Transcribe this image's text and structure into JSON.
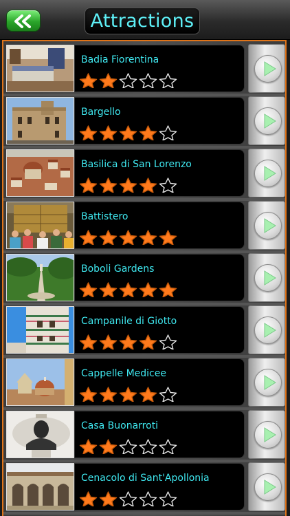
{
  "header": {
    "title": "Attractions",
    "back_icon": "double-chevron-left-icon",
    "colors": {
      "title": "#5ef0f7",
      "back_button": "#2aa52a",
      "frame": "#e07419",
      "star_on": "#ff7a1c"
    }
  },
  "attractions": [
    {
      "name": "Badia Fiorentina",
      "rating": 2,
      "thumb_icon": "interior-room-photo"
    },
    {
      "name": "Bargello",
      "rating": 4,
      "thumb_icon": "palace-photo"
    },
    {
      "name": "Basilica di San Lorenzo",
      "rating": 4,
      "thumb_icon": "city-aerial-photo"
    },
    {
      "name": "Battistero",
      "rating": 5,
      "thumb_icon": "bronze-doors-crowd-photo"
    },
    {
      "name": "Boboli Gardens",
      "rating": 5,
      "thumb_icon": "garden-photo"
    },
    {
      "name": "Campanile di Giotto",
      "rating": 4,
      "thumb_icon": "bell-tower-photo"
    },
    {
      "name": "Cappelle Medicee",
      "rating": 4,
      "thumb_icon": "dome-skyline-photo"
    },
    {
      "name": "Casa Buonarroti",
      "rating": 2,
      "thumb_icon": "bust-sculpture-photo"
    },
    {
      "name": "Cenacolo di Sant'Apollonia",
      "rating": 2,
      "thumb_icon": "arcade-courtyard-photo"
    }
  ],
  "max_rating": 5
}
